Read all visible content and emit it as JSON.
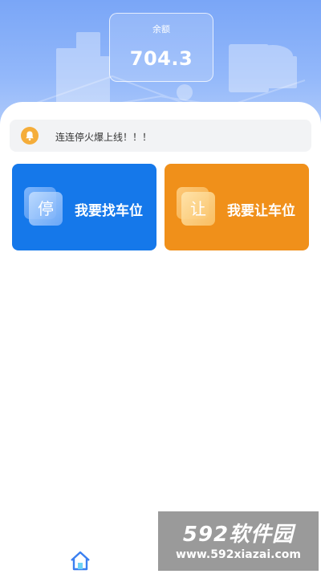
{
  "balance": {
    "label": "余额",
    "value": "704.3"
  },
  "notice": {
    "icon": "bell-icon",
    "text": "连连停火爆上线！！！"
  },
  "actions": {
    "find": {
      "tile_char": "停",
      "label": "我要找车位",
      "color": "#1578ea"
    },
    "yield": {
      "tile_char": "让",
      "label": "我要让车位",
      "color": "#f0901a"
    }
  },
  "tabbar": {
    "home_icon": "home-icon"
  },
  "watermark": {
    "logo": "592软件园",
    "url": "www.592xiazai.com"
  }
}
